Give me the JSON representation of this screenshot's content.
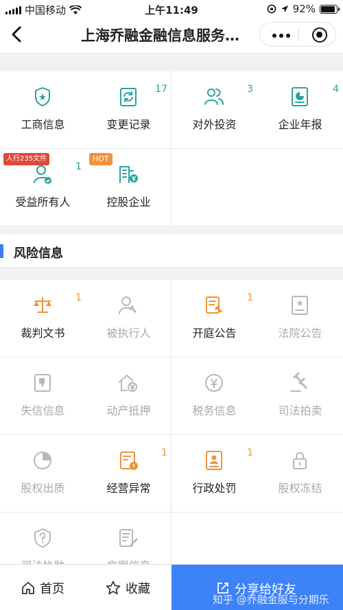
{
  "status": {
    "carrier": "中国移动",
    "time": "上午11:49",
    "battery": "92%",
    "battery_level": 0.92
  },
  "nav": {
    "title": "上海乔融金融信息服务…"
  },
  "colors": {
    "teal": "#2aa39a",
    "orange": "#f0923a",
    "gray": "#b8b8b8",
    "blue": "#3d82f6"
  },
  "basic": {
    "items": [
      {
        "label": "工商信息",
        "count": "",
        "icon": "badge-icon"
      },
      {
        "label": "变更记录",
        "count": "17",
        "icon": "refresh-doc-icon"
      },
      {
        "label": "对外投资",
        "count": "3",
        "icon": "people-icon"
      },
      {
        "label": "企业年报",
        "count": "4",
        "icon": "report-icon"
      },
      {
        "label": "受益所有人",
        "count": "1",
        "icon": "person-check-icon",
        "tag": "人行235文件"
      },
      {
        "label": "控股企业",
        "count": "",
        "icon": "building-yuan-icon",
        "tag": "HOT"
      }
    ]
  },
  "risk": {
    "title": "风险信息",
    "items": [
      {
        "label": "裁判文书",
        "count": "1",
        "icon": "scales-icon"
      },
      {
        "label": "被执行人",
        "count": "",
        "icon": "person-gavel-icon"
      },
      {
        "label": "开庭公告",
        "count": "1",
        "icon": "doc-gavel-icon"
      },
      {
        "label": "法院公告",
        "count": "",
        "icon": "court-notice-icon"
      },
      {
        "label": "失信信息",
        "count": "",
        "icon": "thumb-down-icon"
      },
      {
        "label": "动产抵押",
        "count": "",
        "icon": "house-yuan-icon"
      },
      {
        "label": "税务信息",
        "count": "",
        "icon": "tax-icon"
      },
      {
        "label": "司法拍卖",
        "count": "",
        "icon": "auction-icon"
      },
      {
        "label": "股权出质",
        "count": "",
        "icon": "pie-icon"
      },
      {
        "label": "经营异常",
        "count": "1",
        "icon": "warning-doc-icon"
      },
      {
        "label": "行政处罚",
        "count": "1",
        "icon": "id-card-icon"
      },
      {
        "label": "股权冻结",
        "count": "",
        "icon": "lock-icon"
      },
      {
        "label": "司法协助",
        "count": "",
        "icon": "question-shield-icon"
      },
      {
        "label": "文案信息",
        "count": "",
        "icon": "doc-edit-icon"
      }
    ]
  },
  "bottom": {
    "home": "首页",
    "favorite": "收藏",
    "share": "分享给好友",
    "watermark": "知乎 @乔融金服与分期乐"
  }
}
